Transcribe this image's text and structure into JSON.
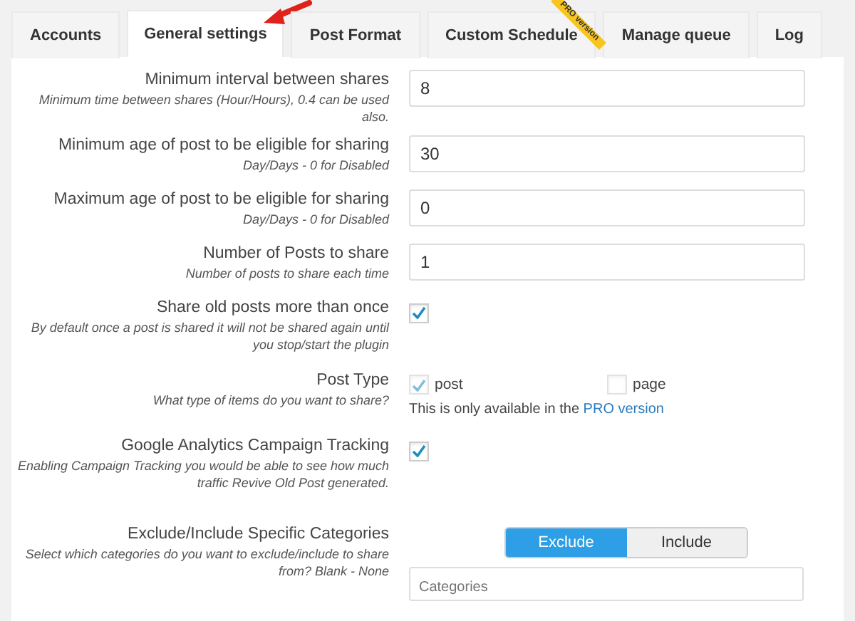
{
  "tabs": [
    {
      "label": "Accounts",
      "selected": false
    },
    {
      "label": "General settings",
      "selected": true,
      "annotated": true
    },
    {
      "label": "Post Format",
      "selected": false
    },
    {
      "label": "Custom Schedule",
      "selected": false,
      "badge": "PRO version"
    },
    {
      "label": "Manage queue",
      "selected": false
    },
    {
      "label": "Log",
      "selected": false
    }
  ],
  "settings": [
    {
      "kind": "number",
      "label": "Minimum interval between shares",
      "description": "Minimum time between shares (Hour/Hours), 0.4 can be used also.",
      "value": "8"
    },
    {
      "kind": "number",
      "label": "Minimum age of post to be eligible for sharing",
      "description": "Day/Days - 0 for Disabled",
      "value": "30"
    },
    {
      "kind": "number",
      "label": "Maximum age of post to be eligible for sharing",
      "description": "Day/Days - 0 for Disabled",
      "value": "0"
    },
    {
      "kind": "number",
      "label": "Number of Posts to share",
      "description": "Number of posts to share each time",
      "value": "1"
    },
    {
      "kind": "checkbox",
      "label": "Share old posts more than once",
      "description": "By default once a post is shared it will not be shared again until you stop/start the plugin",
      "checked": true
    },
    {
      "kind": "options",
      "label": "Post Type",
      "description": "What type of items do you want to share?",
      "options": [
        {
          "label": "post",
          "checked": true,
          "disabled": true
        },
        {
          "label": "page",
          "checked": false,
          "disabled": true
        }
      ],
      "note": "This is only available in the",
      "note_link": "PRO version"
    },
    {
      "kind": "checkbox",
      "label": "Google Analytics Campaign Tracking",
      "description": "Enabling Campaign Tracking you would be able to see how much traffic Revive Old Post generated.",
      "checked": true
    },
    {
      "kind": "categories",
      "label": "Exclude/Include Specific Categories",
      "description": "Select which categories do you want to exclude/include to share from? Blank - None",
      "modes": [
        {
          "label": "Exclude",
          "selected": true
        },
        {
          "label": "Include",
          "selected": false
        }
      ],
      "placeholder": "Categories"
    }
  ]
}
